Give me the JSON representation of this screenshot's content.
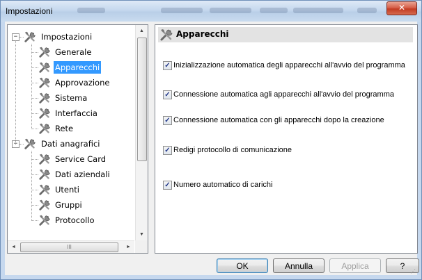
{
  "window": {
    "title": "Impostazioni",
    "close_icon": "close-x"
  },
  "tree": {
    "groups": [
      {
        "label": "Impostazioni",
        "expander": "−",
        "children": [
          "Generale",
          "Apparecchi",
          "Approvazione",
          "Sistema",
          "Interfaccia",
          "Rete"
        ]
      },
      {
        "label": "Dati anagrafici",
        "expander": "−",
        "children": [
          "Service Card",
          "Dati aziendali",
          "Utenti",
          "Gruppi",
          "Protocollo"
        ]
      }
    ],
    "selected": "Apparecchi",
    "item_icon": "tools-icon",
    "scroll_up": "▲",
    "scroll_down": "▼",
    "scroll_left": "◄",
    "scroll_right": "►",
    "scroll_grip": "III"
  },
  "panel": {
    "title": "Apparecchi",
    "options": [
      {
        "label": "Inizializzazione automatica degli apparecchi all'avvio del programma",
        "checked": true
      },
      {
        "label": "Connessione automatica agli apparecchi all'avvio del programma",
        "checked": true
      },
      {
        "label": "Connessione automatica con gli apparecchi dopo la creazione",
        "checked": true
      },
      {
        "label": "Redigi protocollo di comunicazione",
        "checked": true
      },
      {
        "label": "Numero automatico di carichi",
        "checked": true
      }
    ]
  },
  "buttons": {
    "ok": "OK",
    "cancel": "Annulla",
    "apply": "Applica",
    "help": "?"
  },
  "colors": {
    "selection": "#3399ff",
    "titlebar": "#c5d8ee",
    "close": "#c23c23"
  }
}
